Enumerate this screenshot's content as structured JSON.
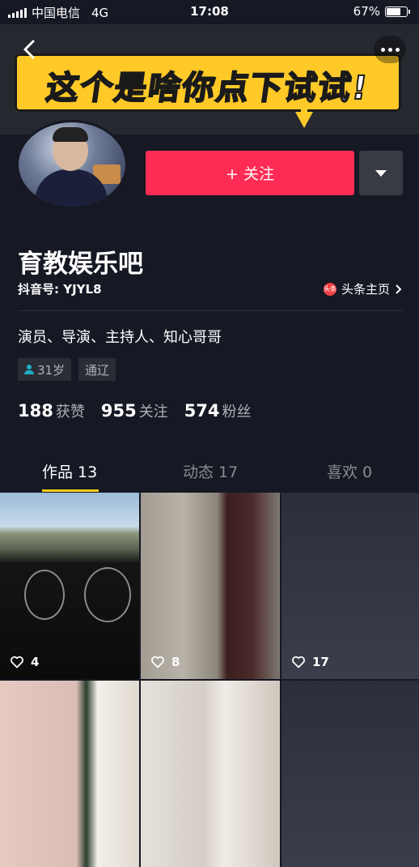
{
  "status_bar": {
    "carrier": "中国电信",
    "network": "4G",
    "time": "17:08",
    "battery_percent": "67%",
    "battery_level": 0.67
  },
  "banner": {
    "text": "这个是啥你点下试试!",
    "accent_color": "#ffc928"
  },
  "profile": {
    "follow_label": "+ 关注",
    "name": "育教娱乐吧",
    "douyin_id": "抖音号: YJYL8",
    "toutiao_link": "头条主页",
    "toutiao_icon_text": "头条",
    "bio": "演员、导演、主持人、知心哥哥",
    "tags": {
      "age": "31岁",
      "location": "通辽"
    },
    "stats": {
      "likes_num": "188",
      "likes_label": "获赞",
      "following_num": "955",
      "following_label": "关注",
      "fans_num": "574",
      "fans_label": "粉丝"
    }
  },
  "tabs": {
    "works": "作品 13",
    "posts": "动态 17",
    "likes": "喜欢 0"
  },
  "videos": [
    {
      "likes": "4"
    },
    {
      "likes": "8"
    },
    {
      "likes": "17"
    }
  ],
  "colors": {
    "background": "#161823",
    "follow_button": "#fe2c55",
    "tab_indicator": "#face15"
  }
}
